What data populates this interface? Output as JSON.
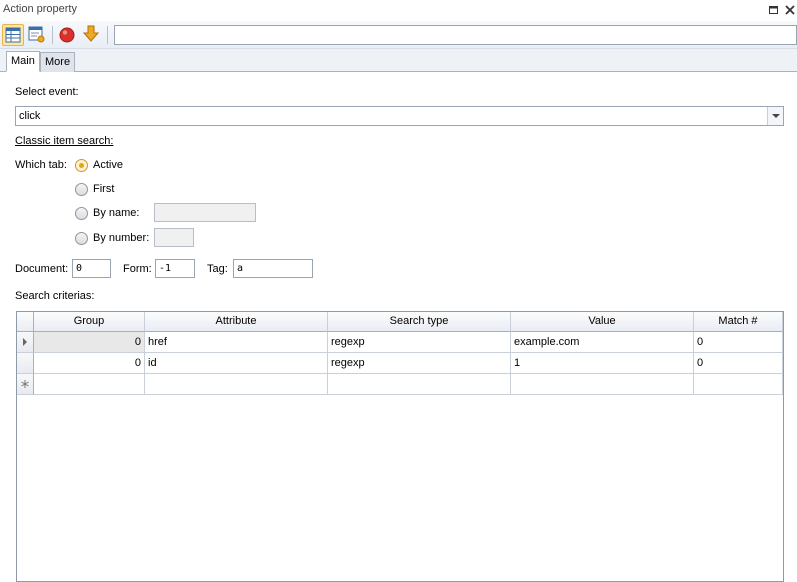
{
  "window": {
    "title": "Action property"
  },
  "toolbar": {
    "url_value": "",
    "buttons": [
      "grid-view-icon",
      "properties-icon",
      "stop-record-icon",
      "download-arrow-icon"
    ]
  },
  "tabs": [
    {
      "label": "Main",
      "selected": true
    },
    {
      "label": "More",
      "selected": false
    }
  ],
  "main": {
    "select_event_label": "Select event:",
    "event_value": "click",
    "classic_search_label": "Classic item search:",
    "which_tab_label": "Which tab:",
    "tab_options": [
      {
        "label": "Active",
        "checked": true
      },
      {
        "label": "First",
        "checked": false
      },
      {
        "label": "By name:",
        "checked": false
      },
      {
        "label": "By number:",
        "checked": false
      }
    ],
    "by_name_value": "",
    "by_number_value": "",
    "document_label": "Document:",
    "document_value": "0",
    "form_label": "Form:",
    "form_value": "-1",
    "tag_label": "Tag:",
    "tag_value": "a",
    "criteria_label": "Search criterias:"
  },
  "grid": {
    "columns": [
      "Group",
      "Attribute",
      "Search type",
      "Value",
      "Match #"
    ],
    "rows": [
      {
        "group": "0",
        "attribute": "href",
        "search_type": "regexp",
        "value": "example.com",
        "match": "0"
      },
      {
        "group": "0",
        "attribute": "id",
        "search_type": "regexp",
        "value": "1",
        "match": "0"
      }
    ]
  },
  "colors": {
    "accent_selected_tool": "#ffe7a3",
    "stop_icon": "#d9302c",
    "arrow_icon": "#f0a81e"
  }
}
